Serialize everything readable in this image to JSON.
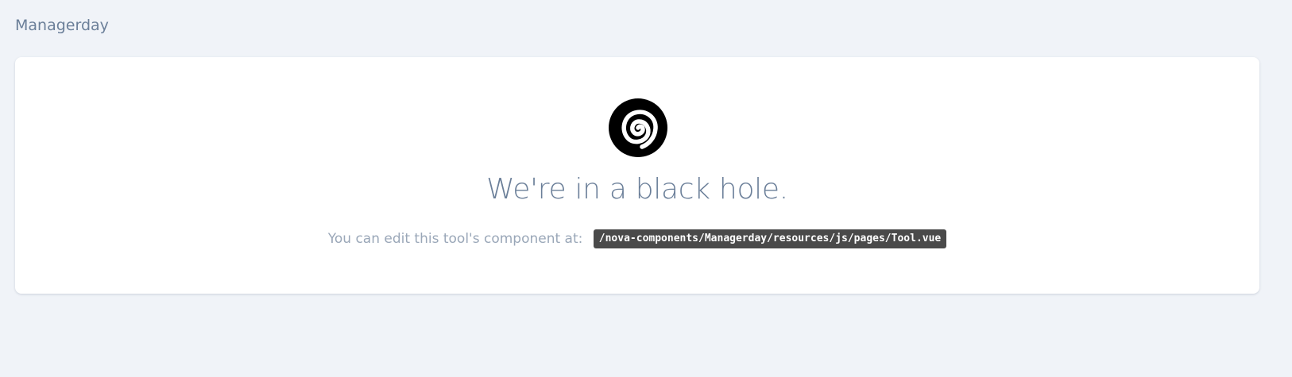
{
  "page": {
    "title": "Managerday"
  },
  "card": {
    "icon": "spiral-logo-icon",
    "headline": "We're in a black hole.",
    "hint_text": "You can edit this tool's component at:",
    "component_path": "/nova-components/Managerday/resources/js/pages/Tool.vue"
  },
  "colors": {
    "background": "#f0f3f8",
    "card": "#ffffff",
    "text": "#6b7f99",
    "muted_text": "#9aa7b8",
    "code_background": "#4a4a4a"
  }
}
